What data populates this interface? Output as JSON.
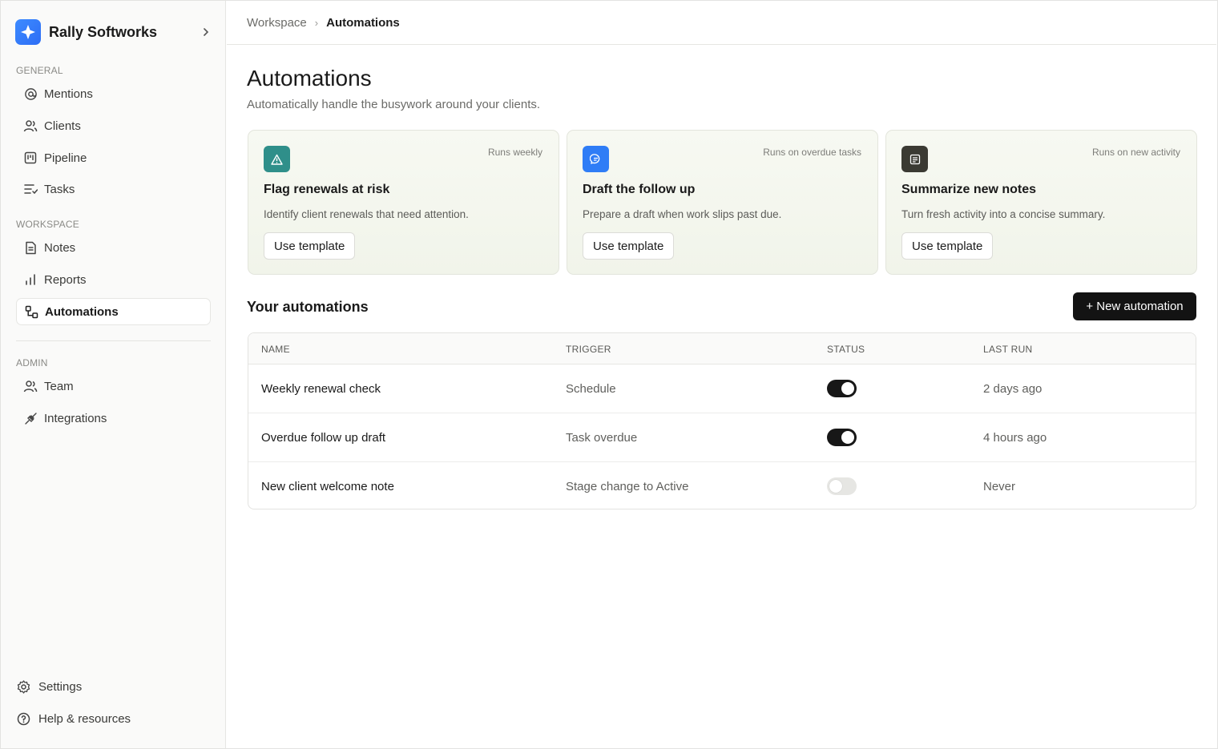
{
  "brand": {
    "name": "Rally Softworks",
    "icon": "rally-logo-icon"
  },
  "breadcrumb": {
    "parent": "Workspace",
    "separator": "›",
    "current": "Automations"
  },
  "sidebar": {
    "sections": [
      {
        "label": "GENERAL",
        "items": [
          {
            "label": "Mentions",
            "icon": "at-sign-icon"
          },
          {
            "label": "Clients",
            "icon": "users-icon"
          },
          {
            "label": "Pipeline",
            "icon": "kanban-icon"
          },
          {
            "label": "Tasks",
            "icon": "list-icon"
          }
        ]
      },
      {
        "label": "WORKSPACE",
        "items": [
          {
            "label": "Notes",
            "icon": "note-icon"
          },
          {
            "label": "Reports",
            "icon": "bar-chart-icon"
          },
          {
            "label": "Automations",
            "icon": "workflow-icon",
            "active": true
          }
        ]
      },
      {
        "label": "ADMIN",
        "items": [
          {
            "label": "Team",
            "icon": "users-icon"
          },
          {
            "label": "Integrations",
            "icon": "plug-icon"
          }
        ]
      }
    ],
    "bottom": [
      {
        "label": "Settings",
        "icon": "gear-icon"
      },
      {
        "label": "Help & resources",
        "icon": "help-circle-icon"
      }
    ]
  },
  "page": {
    "title": "Automations",
    "subtitle": "Automatically handle the busywork around your clients."
  },
  "templates": [
    {
      "title": "Flag renewals at risk",
      "frequency": "Runs weekly",
      "description": "Identify client renewals that need attention.",
      "button": "Use template",
      "icon": "warning-icon",
      "color": "#2f8f8a"
    },
    {
      "title": "Draft the follow up",
      "frequency": "Runs on overdue tasks",
      "description": "Prepare a draft when work slips past due.",
      "button": "Use template",
      "icon": "message-icon",
      "color": "#2f7df6"
    },
    {
      "title": "Summarize new notes",
      "frequency": "Runs on new activity",
      "description": "Turn fresh activity into a concise summary.",
      "button": "Use template",
      "icon": "note-icon",
      "color": "#3b3a33"
    }
  ],
  "automations": {
    "title": "Your automations",
    "new_button": "+ New automation",
    "columns": [
      "NAME",
      "TRIGGER",
      "STATUS",
      "LAST RUN"
    ],
    "rows": [
      {
        "name": "Weekly renewal check",
        "trigger": "Schedule",
        "enabled": true,
        "last_run": "2 days ago"
      },
      {
        "name": "Overdue follow up draft",
        "trigger": "Task overdue",
        "enabled": true,
        "last_run": "4 hours ago"
      },
      {
        "name": "New client welcome note",
        "trigger": "Stage change to Active",
        "enabled": false,
        "last_run": "Never"
      }
    ]
  }
}
